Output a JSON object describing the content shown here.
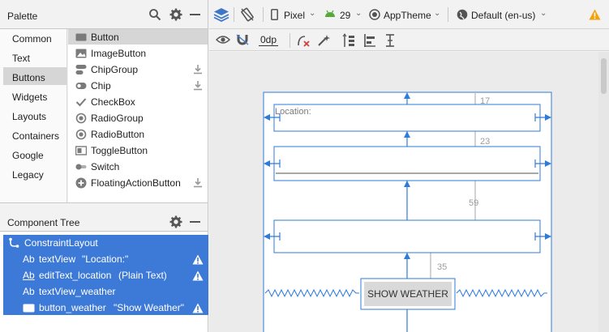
{
  "palette": {
    "title": "Palette",
    "categories": [
      "Common",
      "Text",
      "Buttons",
      "Widgets",
      "Layouts",
      "Containers",
      "Google",
      "Legacy"
    ],
    "selected_category": "Buttons",
    "items": [
      {
        "label": "Button",
        "icon": "button-icon",
        "download": false
      },
      {
        "label": "ImageButton",
        "icon": "image-button-icon",
        "download": false
      },
      {
        "label": "ChipGroup",
        "icon": "chip-group-icon",
        "download": true
      },
      {
        "label": "Chip",
        "icon": "chip-icon",
        "download": true
      },
      {
        "label": "CheckBox",
        "icon": "checkbox-icon",
        "download": false
      },
      {
        "label": "RadioGroup",
        "icon": "radio-group-icon",
        "download": false
      },
      {
        "label": "RadioButton",
        "icon": "radio-button-icon",
        "download": false
      },
      {
        "label": "ToggleButton",
        "icon": "toggle-button-icon",
        "download": false
      },
      {
        "label": "Switch",
        "icon": "switch-icon",
        "download": false
      },
      {
        "label": "FloatingActionButton",
        "icon": "fab-icon",
        "download": true
      }
    ]
  },
  "component_tree": {
    "title": "Component Tree",
    "root": "ConstraintLayout",
    "nodes": [
      {
        "prefix": "Ab",
        "id": "textView",
        "detail": "\"Location:\"",
        "warning": true
      },
      {
        "prefix": "Ab",
        "id": "editText_location",
        "detail": "(Plain Text)",
        "warning": true
      },
      {
        "prefix": "Ab",
        "id": "textView_weather",
        "detail": "",
        "warning": false
      },
      {
        "prefix": "",
        "id": "button_weather",
        "detail": "\"Show Weather\"",
        "warning": true
      }
    ]
  },
  "toolbar": {
    "device": "Pixel",
    "api": "29",
    "theme": "AppTheme",
    "locale": "Default (en-us)",
    "margin": "0dp"
  },
  "canvas": {
    "textview_text": "Location:",
    "button_text": "SHOW WEATHER",
    "margins": [
      "17",
      "23",
      "59",
      "35"
    ]
  },
  "colors": {
    "selection": "#3d7ad8",
    "blueprint": "#2f7bd9",
    "warning": "#f0a30a"
  }
}
